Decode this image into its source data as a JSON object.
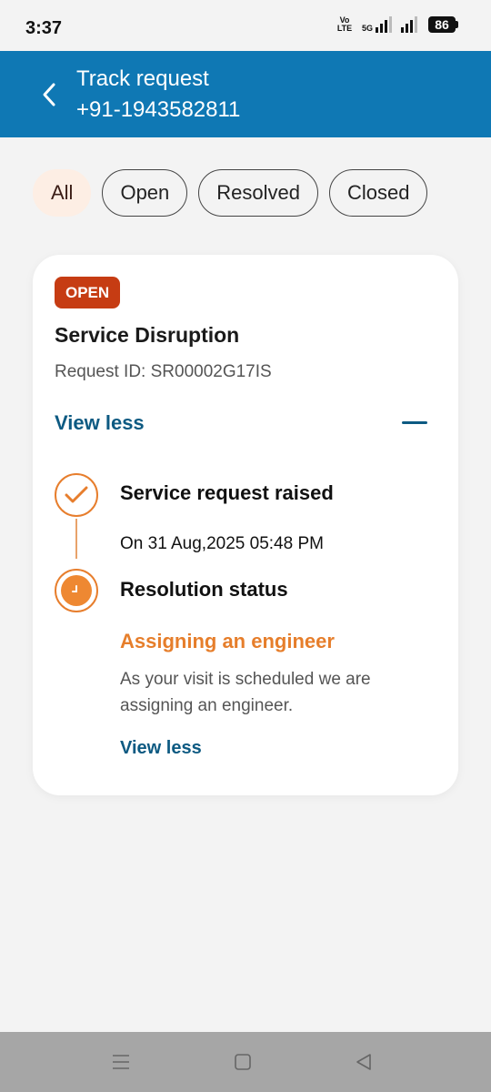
{
  "status_bar": {
    "time": "3:37",
    "volte_label": "Vo LTE",
    "network_label": "5G",
    "battery": "86"
  },
  "header": {
    "title": "Track request",
    "subtitle": "+91-1943582811",
    "back_icon": "chevron-left-icon",
    "background_color": "#0f78b4"
  },
  "filters": [
    {
      "label": "All",
      "active": true
    },
    {
      "label": "Open",
      "active": false
    },
    {
      "label": "Resolved",
      "active": false
    },
    {
      "label": "Closed",
      "active": false
    }
  ],
  "request_card": {
    "badge": "OPEN",
    "badge_color": "#c63c13",
    "title": "Service Disruption",
    "request_id": "Request ID: SR00002G17IS",
    "toggle_label": "View less",
    "timeline": [
      {
        "icon": "checkmark-icon",
        "title": "Service request raised",
        "detail": "On 31 Aug,2025 05:48 PM"
      },
      {
        "icon": "clock-icon",
        "title": "Resolution status",
        "status": "Assigning an engineer",
        "description": "As your visit is scheduled we are assigning an engineer.",
        "link": "View less"
      }
    ],
    "accent_color": "#e67e2b"
  },
  "nav_bar": {
    "buttons": [
      "menu-icon",
      "home-square-icon",
      "back-triangle-icon"
    ]
  }
}
